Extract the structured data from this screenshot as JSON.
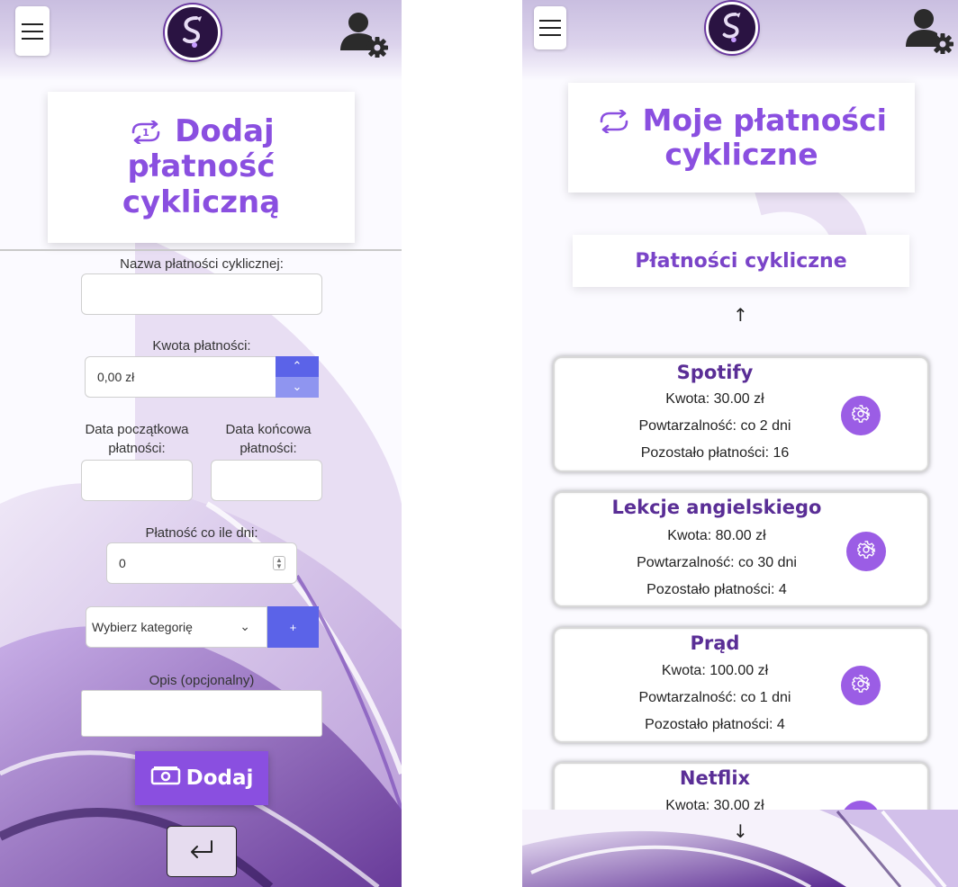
{
  "header": {
    "menu_icon": "hamburger-menu-icon",
    "logo_icon": "dragon-logo-icon",
    "user_icon": "user-settings-icon"
  },
  "add_form": {
    "title_line1": "Dodaj",
    "title_line2": "płatność",
    "title_line3": "cykliczną",
    "title_icon": "repeat-once-icon",
    "name_label": "Nazwa płatności cyklicznej:",
    "name_value": "",
    "amount_label": "Kwota płatności:",
    "amount_value": "0,00 zł",
    "start_label_line1": "Data początkowa",
    "start_label_line2": "płatności:",
    "end_label_line1": "Data końcowa",
    "end_label_line2": "płatności:",
    "interval_label": "Płatność co ile dni:",
    "interval_value": "0",
    "category_placeholder": "Wybierz kategorię",
    "add_category_label": "+",
    "description_label": "Opis (opcjonalny)",
    "submit_label": "Dodaj",
    "submit_icon": "money-icon",
    "back_icon": "return-arrow-icon"
  },
  "list_page": {
    "title_line1": "Moje płatności",
    "title_line2": "cykliczne",
    "title_icon": "repeat-icon",
    "section_title": "Płatności cykliczne",
    "up_arrow": "↑",
    "down_arrow": "↓",
    "payments": [
      {
        "name": "Spotify",
        "amount": "Kwota: 30.00 zł",
        "repeat": "Powtarzalność: co 2 dni",
        "remaining": "Pozostało płatności: 16"
      },
      {
        "name": "Lekcje angielskiego",
        "amount": "Kwota: 80.00 zł",
        "repeat": "Powtarzalność: co 30 dni",
        "remaining": "Pozostało płatności: 4"
      },
      {
        "name": "Prąd",
        "amount": "Kwota: 100.00 zł",
        "repeat": "Powtarzalność: co 1 dni",
        "remaining": "Pozostało płatności: 4"
      },
      {
        "name": "Netflix",
        "amount": "Kwota: 30.00 zł"
      }
    ]
  },
  "colors": {
    "accent": "#8a4fe0",
    "button_blue": "#5b63e8",
    "gear_purple": "#9b5de5",
    "header_lavender": "#c9bee0"
  }
}
